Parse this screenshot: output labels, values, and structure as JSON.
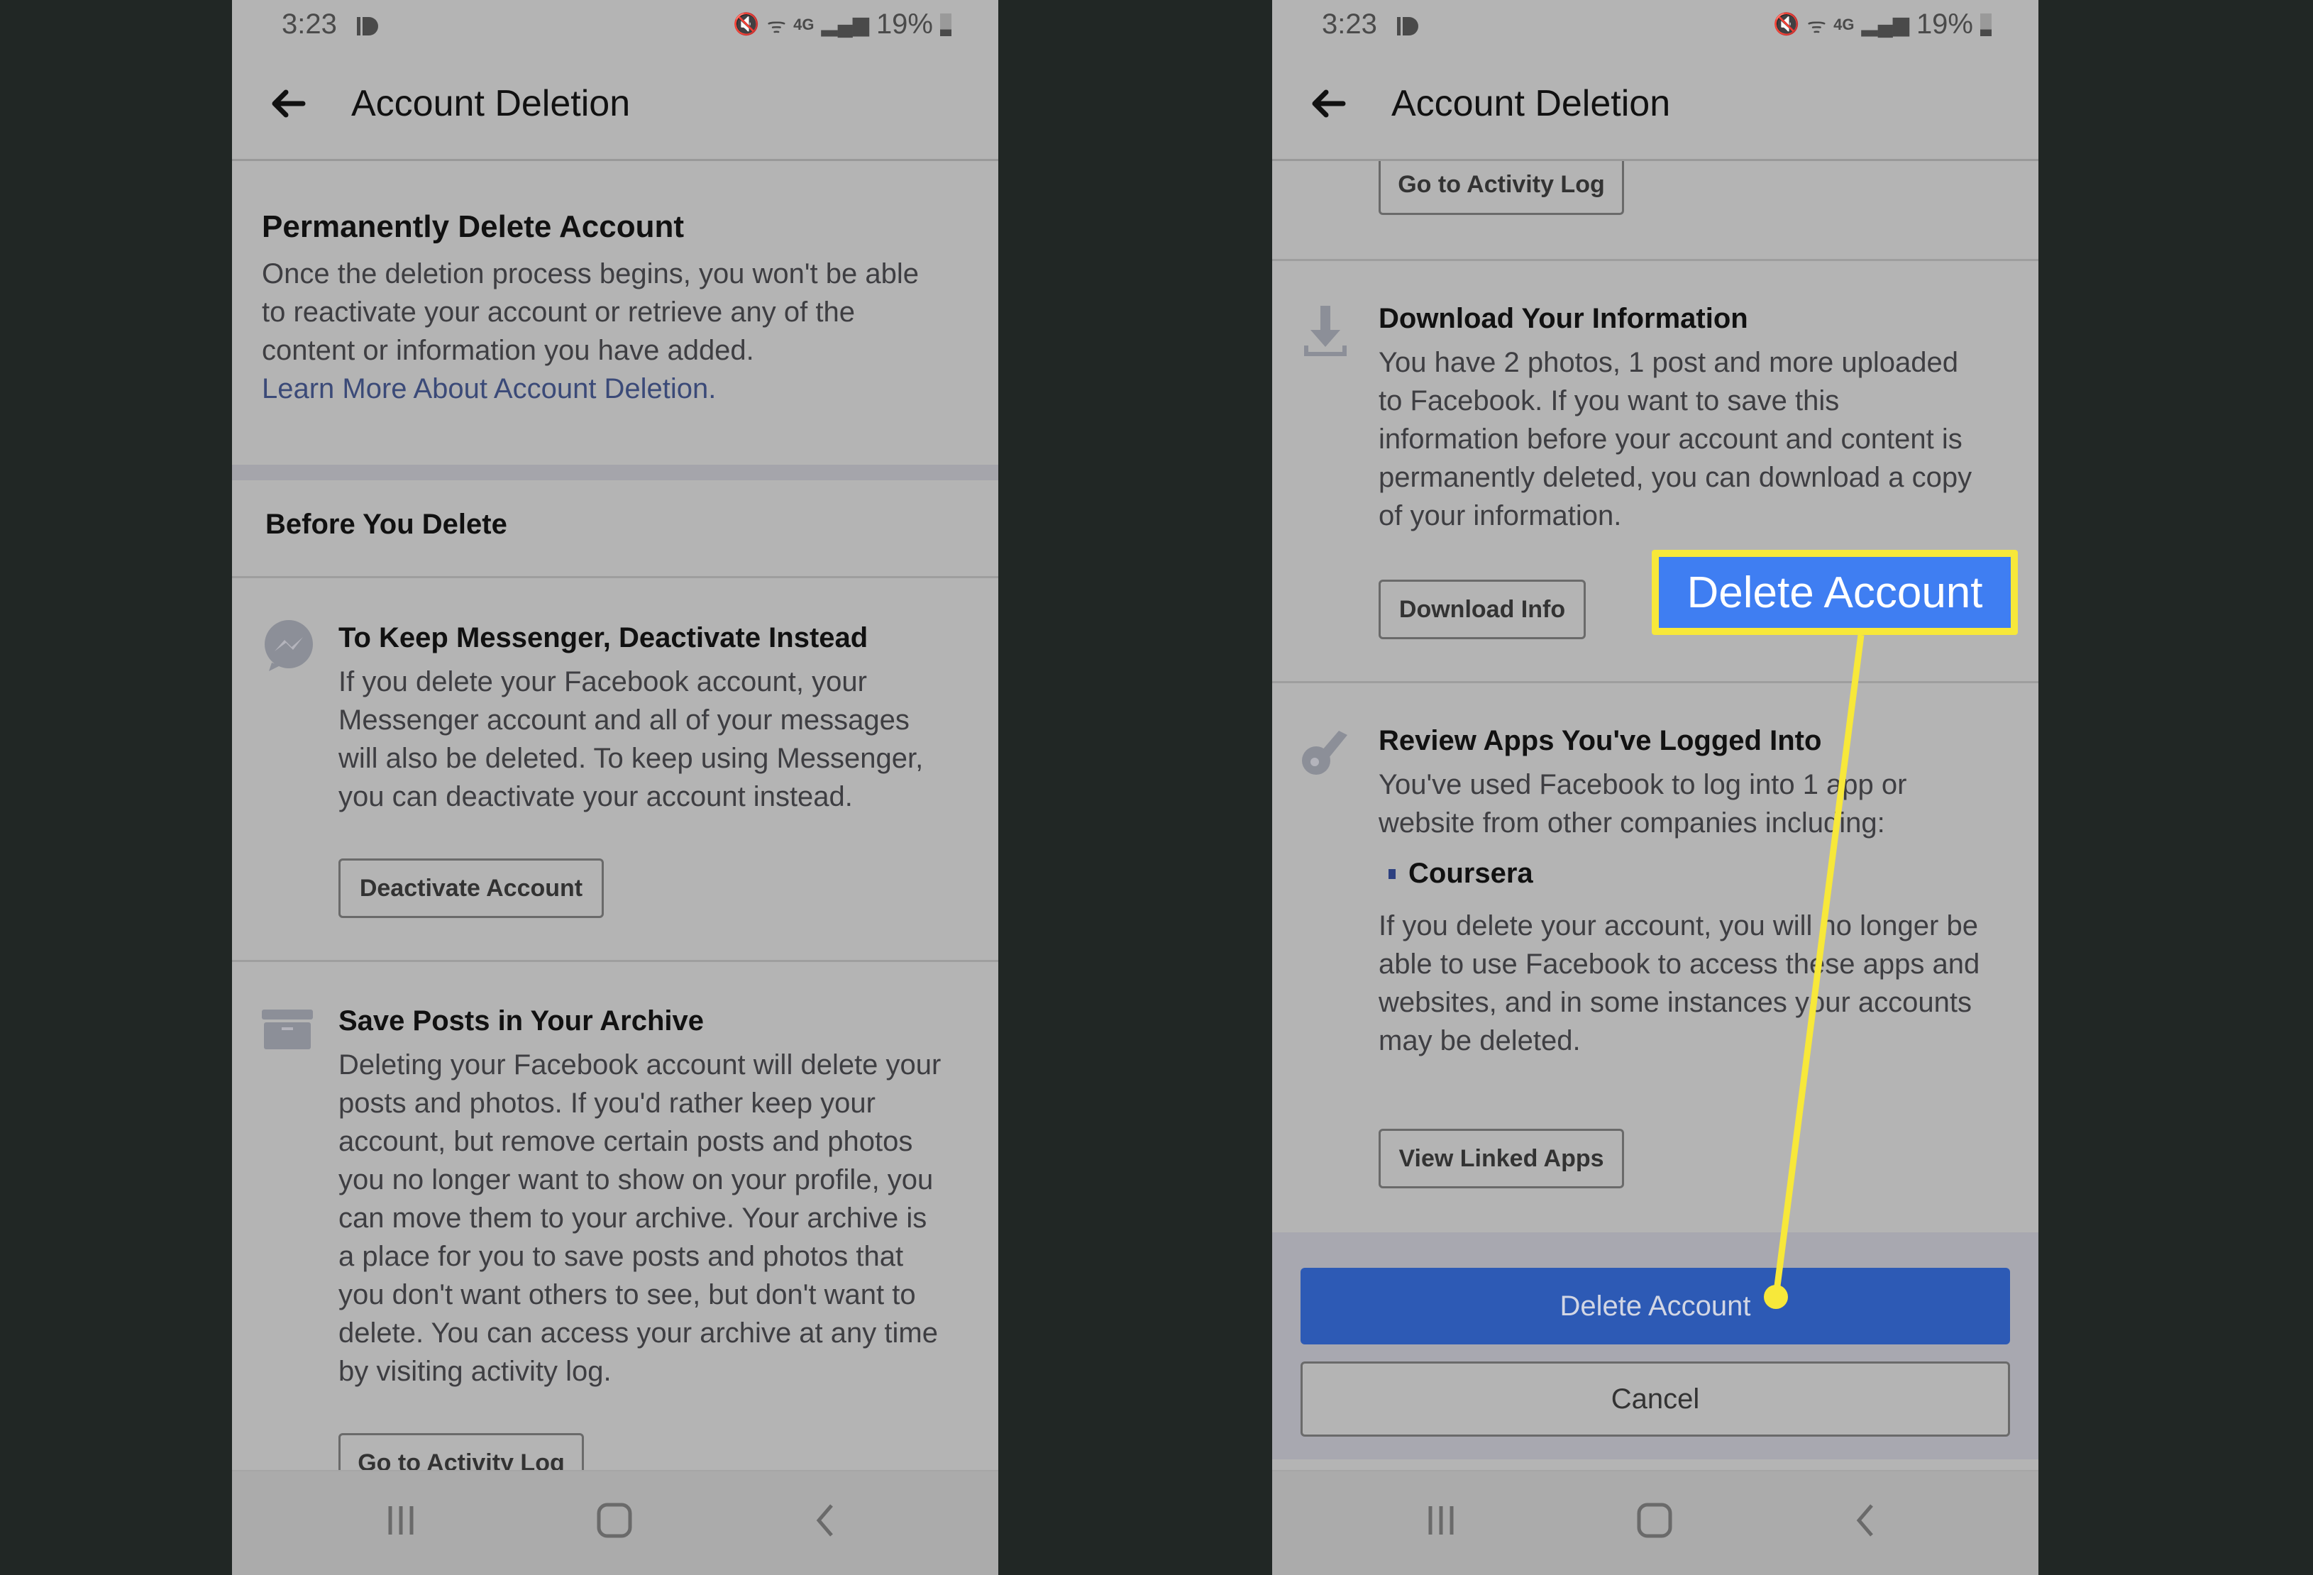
{
  "status_bar": {
    "time": "3:23",
    "battery": "19%",
    "network": "4G"
  },
  "app_bar": {
    "title": "Account Deletion",
    "back_label": "Back"
  },
  "left_screen": {
    "permanent": {
      "heading": "Permanently Delete Account",
      "body_lines": [
        "Once the deletion process begins, you won't be able",
        "to reactivate your account or retrieve any of the",
        "content or information you have added."
      ],
      "link": "Learn More About Account Deletion."
    },
    "before_heading": "Before You Delete",
    "messenger": {
      "heading": "To Keep Messenger, Deactivate Instead",
      "body_lines": [
        "If you delete your Facebook account, your",
        "Messenger account and all of your messages",
        "will also be deleted. To keep using Messenger,",
        "you can deactivate your account instead."
      ],
      "button": "Deactivate Account"
    },
    "archive": {
      "heading": "Save Posts in Your Archive",
      "body_lines": [
        "Deleting your Facebook account will delete your",
        "posts and photos. If you'd rather keep your",
        "account, but remove certain posts and photos",
        "you no longer want to show on your profile, you",
        "can move them to your archive. Your archive is",
        "a place for you to save posts and photos that",
        "you don't want others to see, but don't want to",
        "delete. You can access your archive at any time",
        "by visiting activity log."
      ],
      "button": "Go to Activity Log"
    }
  },
  "right_screen": {
    "activity_button": "Go to Activity Log",
    "download": {
      "heading": "Download Your Information",
      "body_lines": [
        "You have 2 photos, 1 post and more uploaded",
        "to Facebook. If you want to save this",
        "information before your account and content is",
        "permanently deleted, you can download a copy",
        "of your information."
      ],
      "button": "Download Info"
    },
    "apps": {
      "heading": "Review Apps You've Logged Into",
      "body_lines": [
        "You've used Facebook to log into 1 app or",
        "website from other companies including:"
      ],
      "app_list": [
        "Coursera"
      ],
      "warning_lines": [
        "If you delete your account, you will no longer be",
        "able to use Facebook to access these apps and",
        "websites, and in some instances your accounts",
        "may be deleted."
      ],
      "button": "View Linked Apps"
    },
    "delete_button": "Delete Account",
    "cancel_button": "Cancel"
  },
  "callout": {
    "label": "Delete Account",
    "border_color": "#f7e83a",
    "fill_color": "#3f7ef2"
  },
  "colors": {
    "primary_button": "#2d5ab5",
    "link": "#3b4a78",
    "screen_bg": "#b4b4b4",
    "page_bg": "#212725"
  }
}
